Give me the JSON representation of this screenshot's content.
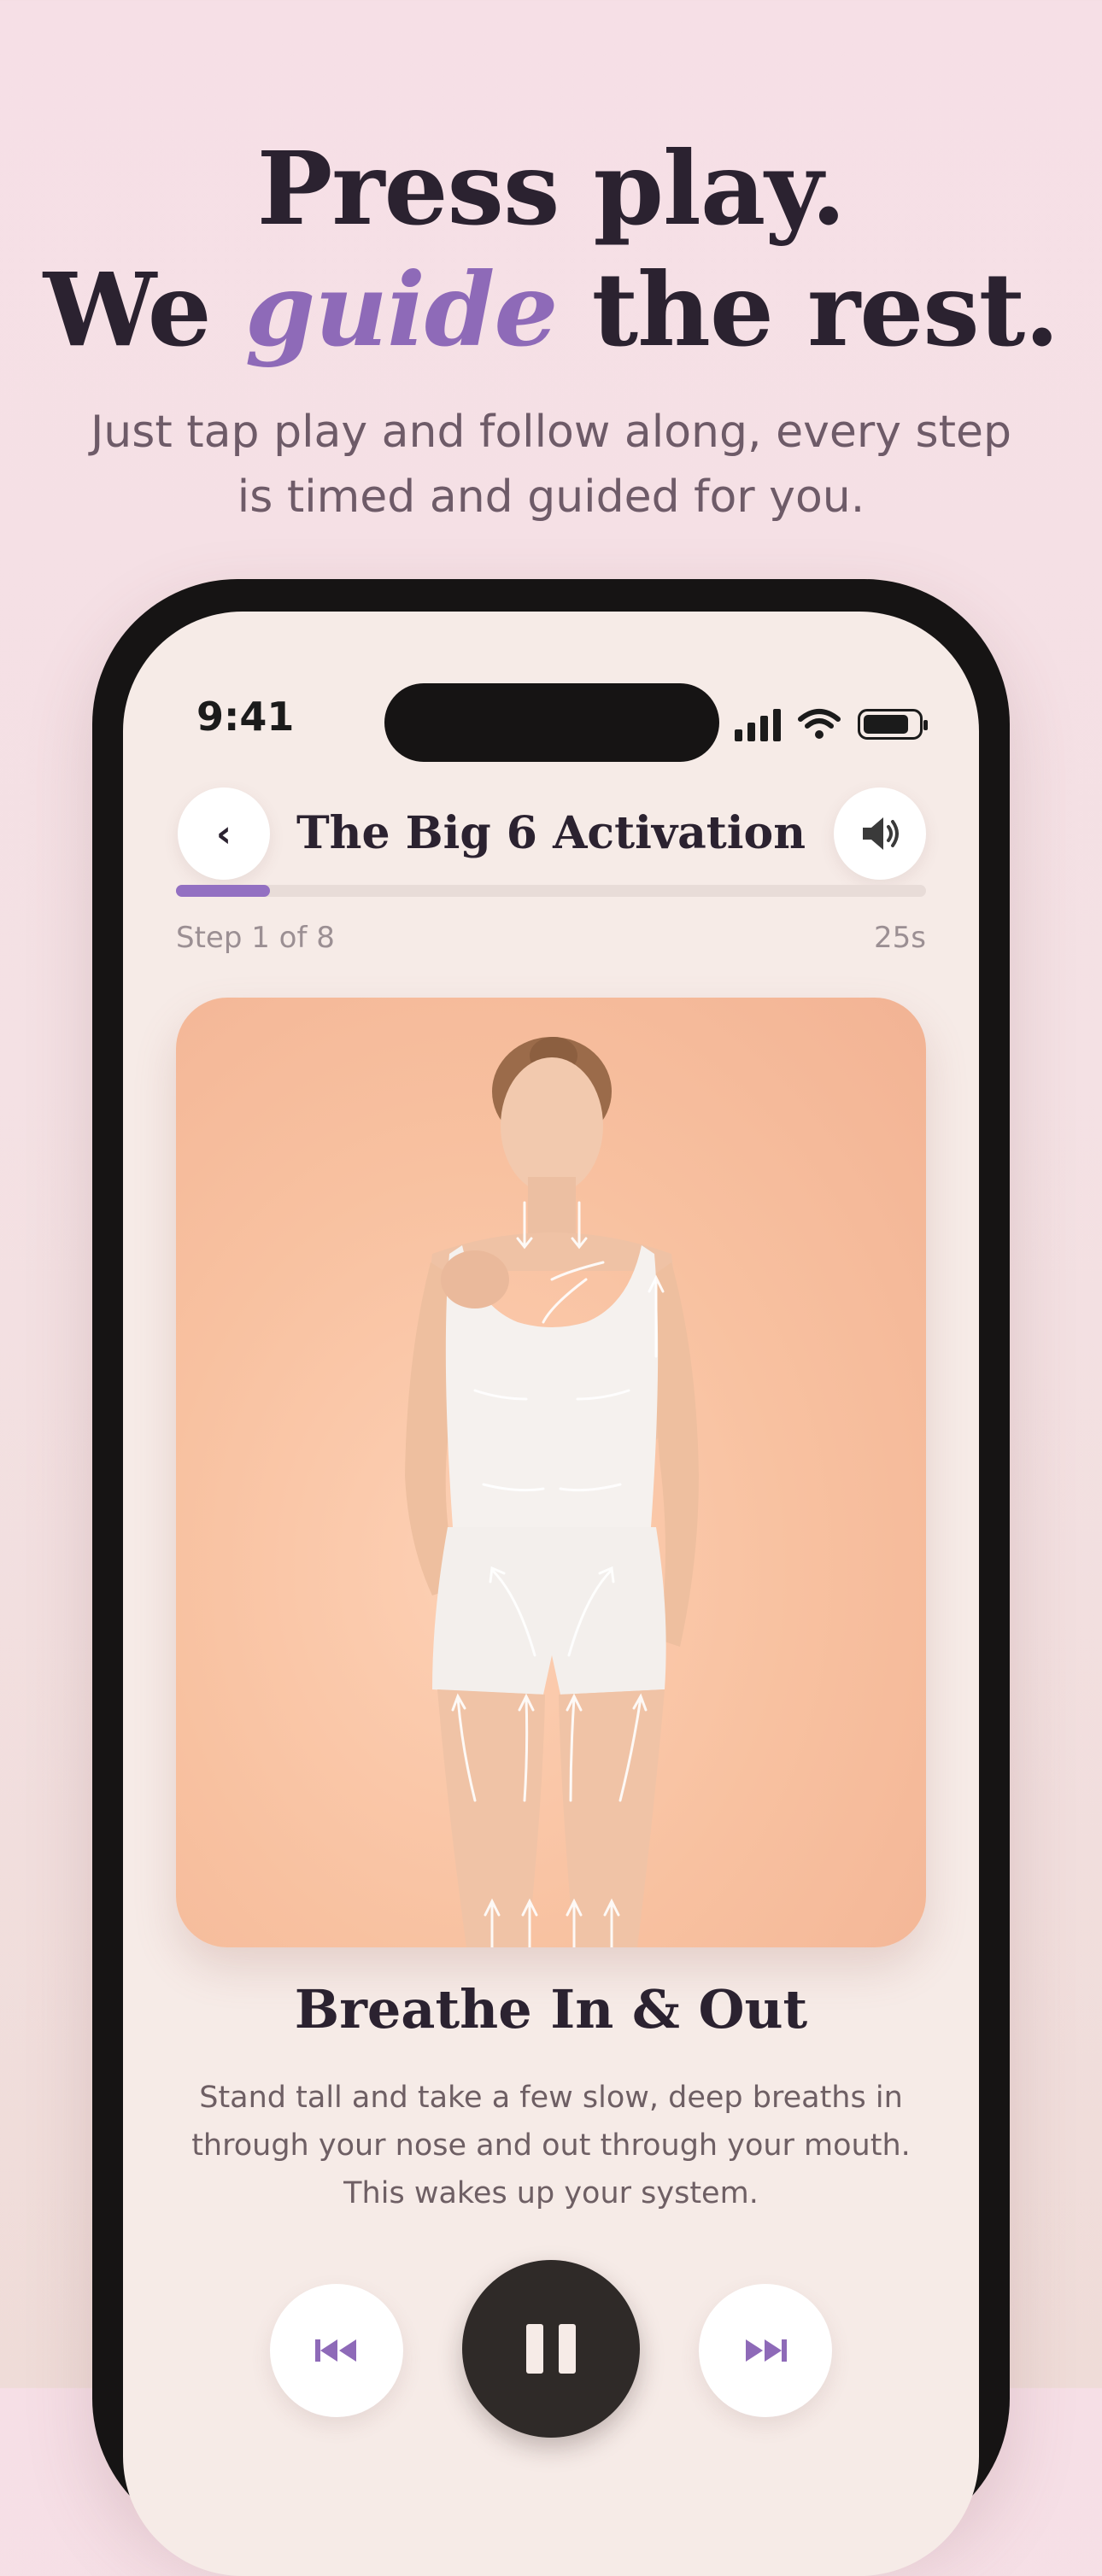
{
  "hero": {
    "line1": "Press play.",
    "line2_prefix": "We ",
    "line2_accent": "guide",
    "line2_suffix": " the rest.",
    "subtitle": "Just tap play and follow along, every step is timed and guided for you."
  },
  "status_bar": {
    "time": "9:41"
  },
  "header": {
    "back_icon": "chevron-left-icon",
    "title": "The Big 6 Activation",
    "sound_icon": "speaker-icon"
  },
  "progress": {
    "fraction": 0.125,
    "step_label": "Step 1 of 8",
    "time_remaining": "25s"
  },
  "exercise": {
    "title": "Breathe In & Out",
    "description": "Stand tall and take a few slow, deep breaths in through your nose and out through your mouth. This wakes up your system."
  },
  "controls": {
    "previous_icon": "skip-previous-icon",
    "pause_icon": "pause-icon",
    "next_icon": "skip-next-icon"
  },
  "colors": {
    "accent": "#8e6ab8",
    "background": "#f6ebe7",
    "dark": "#2f2a28",
    "card": "#f8c1a0"
  }
}
